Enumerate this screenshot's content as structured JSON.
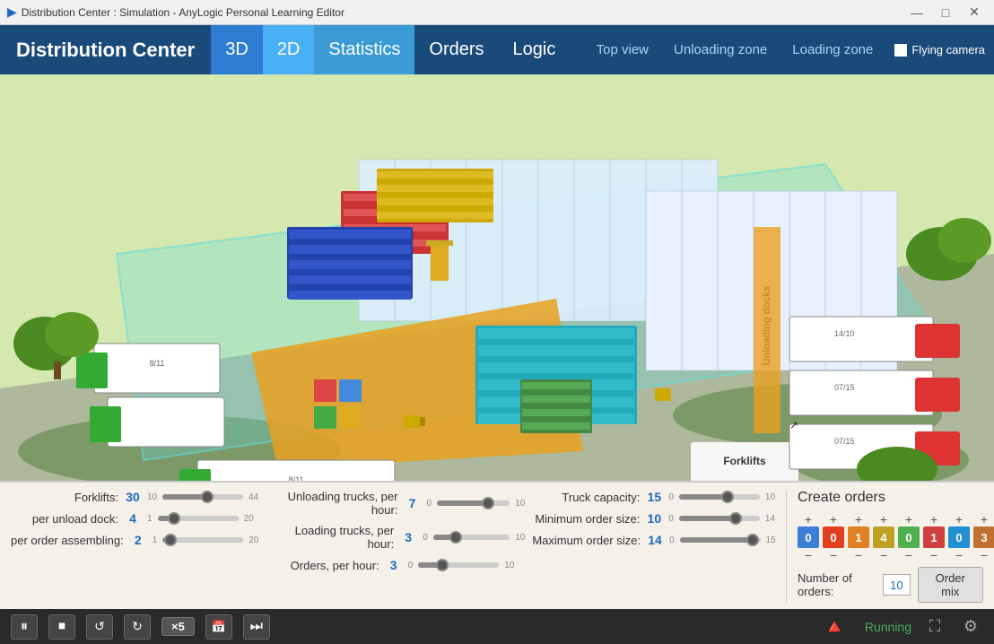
{
  "titleBar": {
    "title": "Distribution Center : Simulation - AnyLogic Personal Learning Editor",
    "icon": "▶",
    "controls": [
      "—",
      "□",
      "✕"
    ]
  },
  "nav": {
    "brand": "Distribution Center",
    "tabs": [
      {
        "label": "3D",
        "active": true,
        "class": "active-3d"
      },
      {
        "label": "2D",
        "active": false,
        "class": "active-2d"
      },
      {
        "label": "Statistics",
        "active": false,
        "class": "active-stats"
      },
      {
        "label": "Orders",
        "active": false
      },
      {
        "label": "Logic",
        "active": false
      }
    ],
    "rightTabs": [
      "Top view",
      "Unloading zone",
      "Loading zone"
    ],
    "flyingCamera": "Flying camera"
  },
  "controls": {
    "col1": [
      {
        "label": "Forklifts:",
        "value": "30",
        "min": "10",
        "max": "44",
        "fillPct": 55
      },
      {
        "label": "per unload dock:",
        "value": "4",
        "min": "1",
        "max": "20",
        "fillPct": 20
      },
      {
        "label": "per order assembling:",
        "value": "2",
        "min": "1",
        "max": "20",
        "fillPct": 10
      }
    ],
    "col2": [
      {
        "label": "Unloading trucks, per hour:",
        "value": "7",
        "min": "0",
        "max": "10",
        "fillPct": 70
      },
      {
        "label": "Loading trucks, per hour:",
        "value": "3",
        "min": "0",
        "max": "10",
        "fillPct": 30
      },
      {
        "label": "Orders, per hour:",
        "value": "3",
        "min": "0",
        "max": "10",
        "fillPct": 30
      }
    ],
    "col3": [
      {
        "label": "Truck capacity:",
        "value": "15",
        "min": "0",
        "max": "10",
        "fillPct": 60
      },
      {
        "label": "Minimum order size:",
        "value": "10",
        "min": "0",
        "max": "14",
        "fillPct": 70
      },
      {
        "label": "Maximum order size:",
        "value": "14",
        "min": "0",
        "max": "15",
        "fillPct": 90
      }
    ]
  },
  "ordersPanel": {
    "title": "Create orders",
    "boxes": [
      {
        "value": "0",
        "color": "#3a7fd5"
      },
      {
        "value": "0",
        "color": "#e04020"
      },
      {
        "value": "1",
        "color": "#e08020"
      },
      {
        "value": "4",
        "color": "#c0a020"
      },
      {
        "value": "0",
        "color": "#50b050"
      },
      {
        "value": "1",
        "color": "#d04040"
      },
      {
        "value": "0",
        "color": "#2090d0"
      },
      {
        "value": "3",
        "color": "#c07030"
      }
    ],
    "numOrdersLabel": "Number of orders:",
    "numOrdersValue": "10",
    "orderMixLabel": "Order mix"
  },
  "statusBar": {
    "pauseBtn": "⏸",
    "stopBtn": "⏹",
    "rewindBtn": "↺",
    "stepBtn": "↻",
    "speedLabel": "×5",
    "calendarBtn": "📅",
    "forwardBtn": "→",
    "runningLabel": "Running"
  }
}
